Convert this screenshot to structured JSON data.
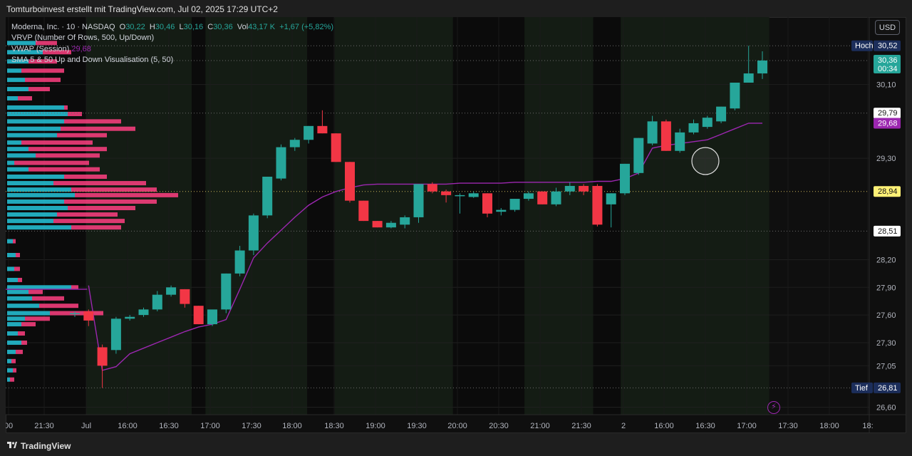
{
  "caption": "Tomturboinvest erstellt mit TradingView.com, Jul 02, 2025 17:29 UTC+2",
  "legend": {
    "symbol": "Moderna, Inc. · 10 · NASDAQ",
    "o_label": "O",
    "o_value": "30,22",
    "h_label": "H",
    "h_value": "30,46",
    "l_label": "L",
    "l_value": "30,16",
    "c_label": "C",
    "c_value": "30,36",
    "vol_label": "Vol",
    "vol_value": "43,17 K",
    "change": "+1,67 (+5,82%)",
    "vrvp": "VRVP (Number Of Rows, 500, Up/Down)",
    "vwap_label": "VWAP (Session)",
    "vwap_value": "29,68",
    "sma": "SMA 5 & 50 Up and Down Visualisation (5, 50)"
  },
  "currency_button": "USD",
  "footer": {
    "brand": "TradingView"
  },
  "colors": {
    "up": "#26a69a",
    "down": "#f23645",
    "vwap": "#9c27b0",
    "profile_up": "#26c6da",
    "profile_down": "#ff4081"
  },
  "chart_data": {
    "type": "candlestick",
    "interval": "10",
    "ylim": [
      26.55,
      30.8
    ],
    "price_ticks": [
      "30,10",
      "29,30",
      "28,20",
      "27,90",
      "27,60",
      "27,30",
      "27,05",
      "26,60"
    ],
    "price_tick_values": [
      30.1,
      29.3,
      28.2,
      27.9,
      27.6,
      27.3,
      27.05,
      26.6
    ],
    "time_ticks": [
      "00",
      "21:30",
      "Jul",
      "16:00",
      "16:30",
      "17:00",
      "17:30",
      "18:00",
      "18:30",
      "19:00",
      "19:30",
      "20:00",
      "20:30",
      "21:00",
      "21:30",
      "2",
      "16:00",
      "16:30",
      "17:00",
      "17:30",
      "18:00",
      "18:"
    ],
    "candles": [
      {
        "o": 27.62,
        "h": 27.64,
        "l": 27.58,
        "c": 27.62
      },
      {
        "o": 27.64,
        "h": 27.66,
        "l": 27.48,
        "c": 27.54
      },
      {
        "o": 27.25,
        "h": 27.28,
        "l": 26.81,
        "c": 27.05
      },
      {
        "o": 27.22,
        "h": 27.58,
        "l": 27.18,
        "c": 27.56
      },
      {
        "o": 27.56,
        "h": 27.6,
        "l": 27.54,
        "c": 27.58
      },
      {
        "o": 27.6,
        "h": 27.68,
        "l": 27.58,
        "c": 27.66
      },
      {
        "o": 27.66,
        "h": 27.86,
        "l": 27.64,
        "c": 27.82
      },
      {
        "o": 27.82,
        "h": 27.92,
        "l": 27.8,
        "c": 27.9
      },
      {
        "o": 27.88,
        "h": 27.88,
        "l": 27.68,
        "c": 27.72
      },
      {
        "o": 27.7,
        "h": 27.7,
        "l": 27.5,
        "c": 27.5
      },
      {
        "o": 27.5,
        "h": 27.64,
        "l": 27.48,
        "c": 27.66
      },
      {
        "o": 27.66,
        "h": 28.05,
        "l": 27.62,
        "c": 28.05
      },
      {
        "o": 28.05,
        "h": 28.35,
        "l": 28.02,
        "c": 28.3
      },
      {
        "o": 28.3,
        "h": 28.7,
        "l": 28.25,
        "c": 28.68
      },
      {
        "o": 28.68,
        "h": 29.1,
        "l": 28.65,
        "c": 29.1
      },
      {
        "o": 29.08,
        "h": 29.45,
        "l": 29.06,
        "c": 29.42
      },
      {
        "o": 29.42,
        "h": 29.52,
        "l": 29.38,
        "c": 29.5
      },
      {
        "o": 29.5,
        "h": 29.65,
        "l": 29.46,
        "c": 29.65
      },
      {
        "o": 29.65,
        "h": 29.82,
        "l": 29.57,
        "c": 29.57
      },
      {
        "o": 29.57,
        "h": 29.57,
        "l": 29.26,
        "c": 29.26
      },
      {
        "o": 29.26,
        "h": 29.26,
        "l": 28.82,
        "c": 28.84
      },
      {
        "o": 28.84,
        "h": 28.84,
        "l": 28.62,
        "c": 28.62
      },
      {
        "o": 28.62,
        "h": 28.62,
        "l": 28.55,
        "c": 28.55
      },
      {
        "o": 28.55,
        "h": 28.62,
        "l": 28.54,
        "c": 28.6
      },
      {
        "o": 28.58,
        "h": 28.68,
        "l": 28.54,
        "c": 28.66
      },
      {
        "o": 28.66,
        "h": 29.02,
        "l": 28.6,
        "c": 29.02
      },
      {
        "o": 29.02,
        "h": 29.04,
        "l": 28.92,
        "c": 28.94
      },
      {
        "o": 28.94,
        "h": 28.96,
        "l": 28.82,
        "c": 28.9
      },
      {
        "o": 28.9,
        "h": 28.92,
        "l": 28.7,
        "c": 28.9
      },
      {
        "o": 28.88,
        "h": 28.94,
        "l": 28.87,
        "c": 28.92
      },
      {
        "o": 28.92,
        "h": 28.92,
        "l": 28.66,
        "c": 28.7
      },
      {
        "o": 28.72,
        "h": 28.76,
        "l": 28.68,
        "c": 28.74
      },
      {
        "o": 28.74,
        "h": 28.86,
        "l": 28.72,
        "c": 28.86
      },
      {
        "o": 28.86,
        "h": 28.94,
        "l": 28.84,
        "c": 28.92
      },
      {
        "o": 28.94,
        "h": 28.94,
        "l": 28.8,
        "c": 28.8
      },
      {
        "o": 28.8,
        "h": 28.98,
        "l": 28.78,
        "c": 28.94
      },
      {
        "o": 28.94,
        "h": 29.04,
        "l": 28.9,
        "c": 29.0
      },
      {
        "o": 29.0,
        "h": 29.02,
        "l": 28.9,
        "c": 28.94
      },
      {
        "o": 29.0,
        "h": 29.02,
        "l": 28.56,
        "c": 28.58
      },
      {
        "o": 28.8,
        "h": 28.92,
        "l": 28.55,
        "c": 28.92
      },
      {
        "o": 28.92,
        "h": 29.24,
        "l": 28.9,
        "c": 29.24
      },
      {
        "o": 29.14,
        "h": 29.52,
        "l": 29.12,
        "c": 29.52
      },
      {
        "o": 29.46,
        "h": 29.76,
        "l": 29.44,
        "c": 29.7
      },
      {
        "o": 29.7,
        "h": 29.72,
        "l": 29.38,
        "c": 29.38
      },
      {
        "o": 29.38,
        "h": 29.62,
        "l": 29.36,
        "c": 29.58
      },
      {
        "o": 29.58,
        "h": 29.72,
        "l": 29.56,
        "c": 29.68
      },
      {
        "o": 29.64,
        "h": 29.76,
        "l": 29.62,
        "c": 29.74
      },
      {
        "o": 29.7,
        "h": 29.86,
        "l": 29.68,
        "c": 29.86
      },
      {
        "o": 29.84,
        "h": 30.12,
        "l": 29.82,
        "c": 30.12
      },
      {
        "o": 30.12,
        "h": 30.52,
        "l": 30.12,
        "c": 30.22
      },
      {
        "o": 30.22,
        "h": 30.46,
        "l": 30.16,
        "c": 30.36
      }
    ],
    "vwap": [
      null,
      27.92,
      27.0,
      27.04,
      27.18,
      27.24,
      27.3,
      27.36,
      27.42,
      27.47,
      27.5,
      27.55,
      27.88,
      28.22,
      28.38,
      28.52,
      28.66,
      28.79,
      28.88,
      28.94,
      28.98,
      29.01,
      29.02,
      29.02,
      29.02,
      29.02,
      29.02,
      29.02,
      29.03,
      29.03,
      29.03,
      29.03,
      29.04,
      29.04,
      29.04,
      29.04,
      29.04,
      29.04,
      29.05,
      29.05,
      29.08,
      29.14,
      29.41,
      29.44,
      29.46,
      29.48,
      29.5,
      29.56,
      29.62,
      29.68,
      29.68
    ],
    "price_labels": [
      {
        "text": "30,52",
        "tag": "Hoch",
        "value": 30.52,
        "style": "navy"
      },
      {
        "text": "30,36",
        "sub": "00:34",
        "value": 30.36,
        "style": "up"
      },
      {
        "text": "29,79",
        "value": 29.79,
        "style": "white"
      },
      {
        "text": "29,68",
        "value": 29.68,
        "style": "vwap"
      },
      {
        "text": "28,94",
        "value": 28.94,
        "style": "yellow"
      },
      {
        "text": "28,51",
        "value": 28.51,
        "style": "white"
      },
      {
        "text": "26,81",
        "tag": "Tief",
        "value": 26.81,
        "style": "navy"
      }
    ],
    "levels": [
      30.52,
      30.36,
      29.79,
      28.94,
      28.51,
      26.81
    ],
    "sessions": [
      {
        "from": 0,
        "to": 1.3,
        "kind": "dark"
      },
      {
        "from": 1.3,
        "to": 4.3,
        "kind": "green"
      },
      {
        "from": 4.3,
        "to": 9.0,
        "kind": "green"
      },
      {
        "from": 9.0,
        "to": 10.0,
        "kind": "dark"
      },
      {
        "from": 10.0,
        "to": 17.4,
        "kind": "green"
      },
      {
        "from": 17.4,
        "to": 19.4,
        "kind": "dark"
      },
      {
        "from": 19.4,
        "to": 28.0,
        "kind": "green"
      },
      {
        "from": 28.0,
        "to": 33.2,
        "kind": "dark"
      },
      {
        "from": 33.2,
        "to": 38.2,
        "kind": "green"
      },
      {
        "from": 38.2,
        "to": 40.2,
        "kind": "dark"
      },
      {
        "from": 40.2,
        "to": 51.0,
        "kind": "green"
      }
    ],
    "volume_profile": [
      {
        "price": 30.55,
        "up": 40,
        "down": 30
      },
      {
        "price": 30.45,
        "up": 50,
        "down": 40
      },
      {
        "price": 30.35,
        "up": 30,
        "down": 40
      },
      {
        "price": 30.25,
        "up": 20,
        "down": 60
      },
      {
        "price": 30.15,
        "up": 25,
        "down": 50
      },
      {
        "price": 30.05,
        "up": 30,
        "down": 30
      },
      {
        "price": 29.95,
        "up": 15,
        "down": 20
      },
      {
        "price": 29.85,
        "up": 80,
        "down": 5
      },
      {
        "price": 29.78,
        "up": 85,
        "down": 20
      },
      {
        "price": 29.7,
        "up": 80,
        "down": 80
      },
      {
        "price": 29.62,
        "up": 75,
        "down": 105
      },
      {
        "price": 29.55,
        "up": 70,
        "down": 70
      },
      {
        "price": 29.47,
        "up": 20,
        "down": 100
      },
      {
        "price": 29.4,
        "up": 30,
        "down": 110
      },
      {
        "price": 29.33,
        "up": 40,
        "down": 90
      },
      {
        "price": 29.25,
        "up": 10,
        "down": 105
      },
      {
        "price": 29.18,
        "up": 30,
        "down": 100
      },
      {
        "price": 29.1,
        "up": 80,
        "down": 60
      },
      {
        "price": 29.03,
        "up": 65,
        "down": 130
      },
      {
        "price": 28.96,
        "up": 90,
        "down": 120
      },
      {
        "price": 28.9,
        "up": 95,
        "down": 145
      },
      {
        "price": 28.83,
        "up": 80,
        "down": 130
      },
      {
        "price": 28.76,
        "up": 85,
        "down": 95
      },
      {
        "price": 28.69,
        "up": 70,
        "down": 85
      },
      {
        "price": 28.62,
        "up": 65,
        "down": 100
      },
      {
        "price": 28.55,
        "up": 90,
        "down": 70
      },
      {
        "price": 28.4,
        "up": 8,
        "down": 4
      },
      {
        "price": 28.25,
        "up": 12,
        "down": 6
      },
      {
        "price": 28.1,
        "up": 10,
        "down": 8
      },
      {
        "price": 27.98,
        "up": 15,
        "down": 6
      },
      {
        "price": 27.9,
        "up": 90,
        "down": 10
      },
      {
        "price": 27.85,
        "up": 30,
        "down": 20
      },
      {
        "price": 27.78,
        "up": 35,
        "down": 45
      },
      {
        "price": 27.7,
        "up": 45,
        "down": 55
      },
      {
        "price": 27.62,
        "up": 60,
        "down": 75
      },
      {
        "price": 27.56,
        "up": 25,
        "down": 35
      },
      {
        "price": 27.5,
        "up": 20,
        "down": 20
      },
      {
        "price": 27.4,
        "up": 15,
        "down": 10
      },
      {
        "price": 27.3,
        "up": 20,
        "down": 8
      },
      {
        "price": 27.2,
        "up": 12,
        "down": 10
      },
      {
        "price": 27.1,
        "up": 6,
        "down": 6
      },
      {
        "price": 27.0,
        "up": 8,
        "down": 5
      },
      {
        "price": 26.9,
        "up": 4,
        "down": 6
      }
    ]
  }
}
